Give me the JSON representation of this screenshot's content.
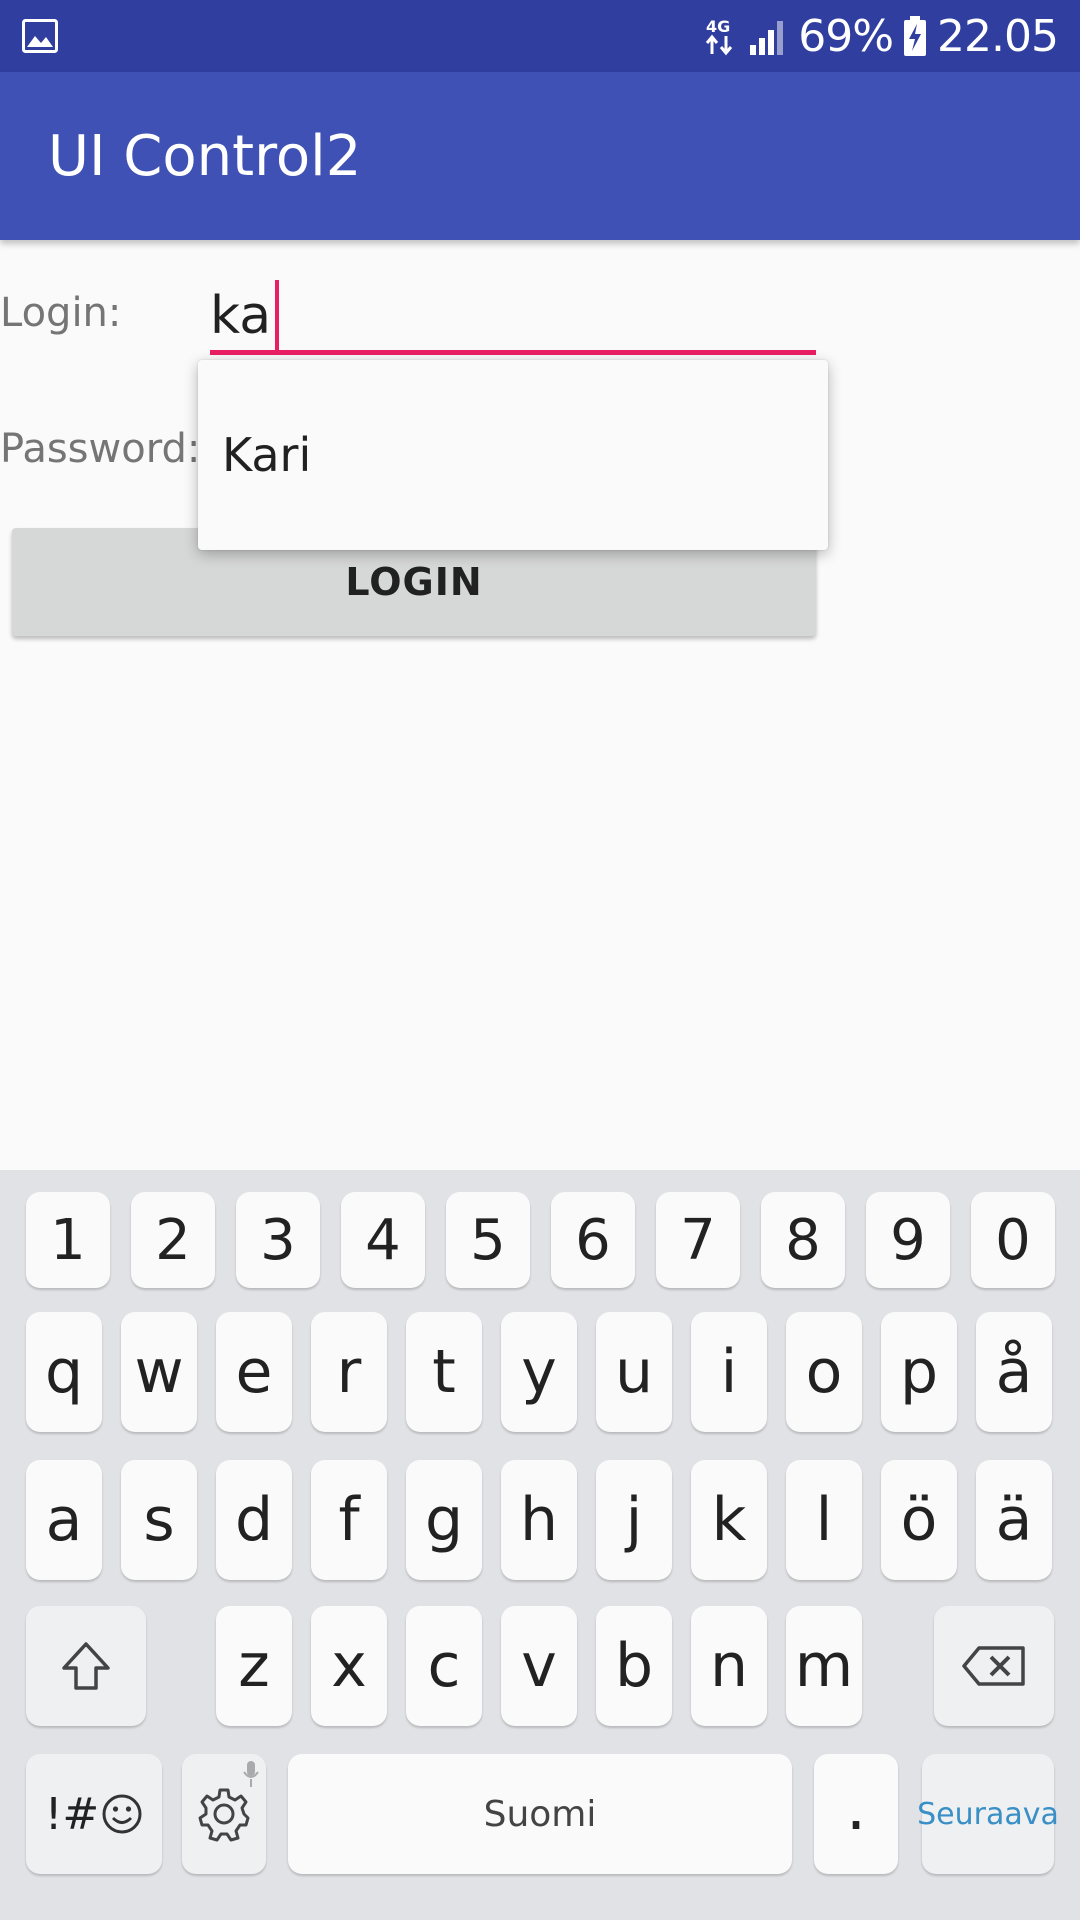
{
  "status_bar": {
    "left_icon": "gallery-icon",
    "network": "4G",
    "signal_icon": "signal-icon",
    "battery_percent": "69%",
    "battery_icon": "battery-charging-icon",
    "time": "22.05"
  },
  "app_bar": {
    "title": "UI Control2"
  },
  "form": {
    "login_label": "Login:",
    "login_value": "ka",
    "password_label": "Password:",
    "login_button": "LOGIN"
  },
  "autocomplete": {
    "suggestions": [
      "Kari"
    ]
  },
  "keyboard": {
    "number_row": [
      "1",
      "2",
      "3",
      "4",
      "5",
      "6",
      "7",
      "8",
      "9",
      "0"
    ],
    "row1": [
      "q",
      "w",
      "e",
      "r",
      "t",
      "y",
      "u",
      "i",
      "o",
      "p",
      "å"
    ],
    "row2": [
      "a",
      "s",
      "d",
      "f",
      "g",
      "h",
      "j",
      "k",
      "l",
      "ö",
      "ä"
    ],
    "row3": [
      "z",
      "x",
      "c",
      "v",
      "b",
      "n",
      "m"
    ],
    "shift_icon": "shift-icon",
    "backspace_icon": "backspace-icon",
    "symbols_label": "!#",
    "emoji_icon": "emoji-icon",
    "settings_icon": "gear-icon",
    "mic_icon": "mic-icon",
    "space_label": "Suomi",
    "period_label": ".",
    "action_label": "Seuraava",
    "colors": {
      "action": "#3a8fc6",
      "accent": "#e91e63",
      "app_bar": "#3f51b5",
      "status_bar": "#303f9f"
    }
  }
}
